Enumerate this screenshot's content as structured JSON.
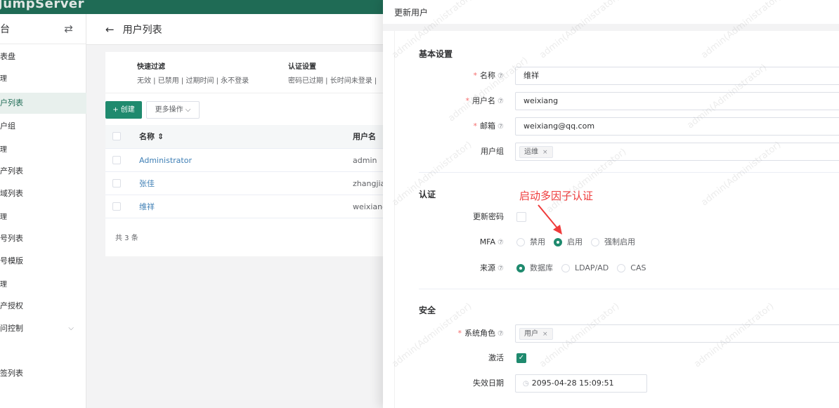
{
  "app": {
    "brand": "JumpServer"
  },
  "sidebar": {
    "title": "台",
    "items": [
      {
        "label": "表盘"
      },
      {
        "label": "理"
      },
      {
        "label": "户列表"
      },
      {
        "label": "户组"
      },
      {
        "label": "理"
      },
      {
        "label": "产列表"
      },
      {
        "label": "域列表"
      },
      {
        "label": "理"
      },
      {
        "label": "号列表"
      },
      {
        "label": "号模版"
      },
      {
        "label": "理"
      },
      {
        "label": "产授权"
      },
      {
        "label": "问控制"
      },
      {
        "label": "签列表"
      }
    ]
  },
  "page": {
    "title": "用户列表"
  },
  "filters": {
    "quick": {
      "title": "快速过滤",
      "values": "无效 | 已禁用 | 过期时间 | 永不登录"
    },
    "auth": {
      "title": "认证设置",
      "values": "密码已过期 | 长时间未登录 |"
    }
  },
  "toolbar": {
    "create_label": "+ 创建",
    "more_label": "更多操作 ⌵"
  },
  "table": {
    "columns": {
      "name": "名称 ⇕",
      "username": "用户名"
    },
    "rows": [
      {
        "name": "Administrator",
        "username": "admin"
      },
      {
        "name": "张佳",
        "username": "zhangjia"
      },
      {
        "name": "维祥",
        "username": "weixiang"
      }
    ],
    "total": "共 3 条"
  },
  "drawer": {
    "title": "更新用户",
    "basic": {
      "section": "基本设置",
      "name_label": "名称",
      "name_value": "维祥",
      "username_label": "用户名",
      "username_value": "weixiang",
      "email_label": "邮箱",
      "email_value": "weixiang@qq.com",
      "group_label": "用户组",
      "group_tag": "运维"
    },
    "auth": {
      "section": "认证",
      "update_pwd_label": "更新密码",
      "mfa_label": "MFA",
      "mfa_options": [
        "禁用",
        "启用",
        "强制启用"
      ],
      "mfa_selected": "启用",
      "source_label": "来源",
      "source_options": [
        "数据库",
        "LDAP/AD",
        "CAS"
      ],
      "source_selected": "数据库"
    },
    "security": {
      "section": "安全",
      "role_label": "系统角色",
      "role_tag": "用户",
      "active_label": "激活",
      "expire_label": "失效日期",
      "expire_value": "2095-04-28 15:09:51"
    }
  },
  "annotation": {
    "text": "启动多因子认证",
    "color": "#ef3b3b"
  },
  "watermark": "admin(Administrator)",
  "colors": {
    "primary": "#1f8a6e",
    "header": "#1f6b55",
    "required": "#f56c6c",
    "link": "#3f7fb5"
  }
}
